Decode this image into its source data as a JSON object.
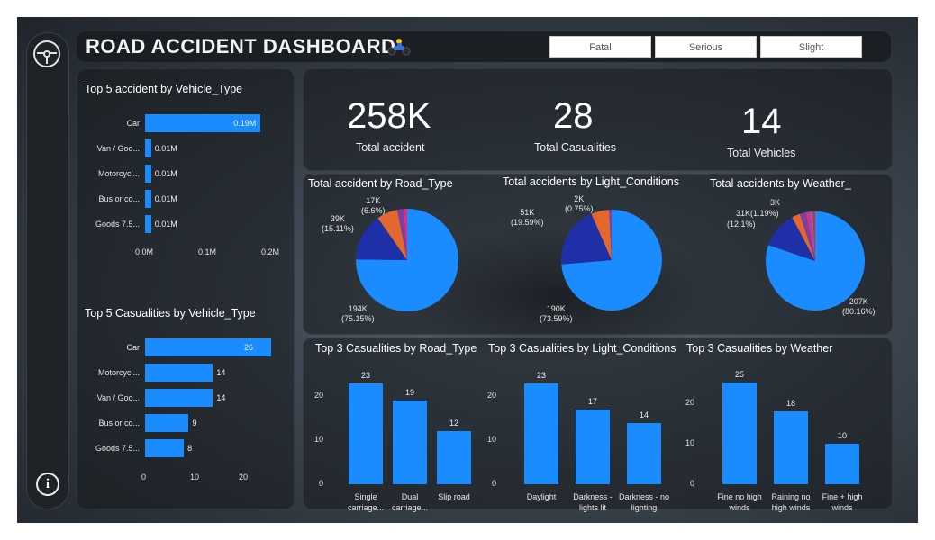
{
  "header": {
    "title": "ROAD ACCIDENT DASHBOARD",
    "slicers": [
      "Fatal",
      "Serious",
      "Slight"
    ]
  },
  "kpis": [
    {
      "value": "258K",
      "label": "Total accident"
    },
    {
      "value": "28",
      "label": "Total Casualities"
    },
    {
      "value": "14",
      "label": "Total Vehicles"
    }
  ],
  "icons": {
    "nav_top": "steering-wheel-icon",
    "nav_bottom": "info-icon",
    "title_icon": "motorbike-rider-icon"
  },
  "colors": {
    "bar": "#1a8cff",
    "pie_main": "#1a8cff",
    "pie_second": "#1f2fa8",
    "pie_third": "#e3682f",
    "pie_fourth": "#7b3fa8",
    "pie_fifth": "#d6337a"
  },
  "chart_data": [
    {
      "type": "bar",
      "orientation": "horizontal",
      "title": "Top 5 accident by Vehicle_Type",
      "categories": [
        "Car",
        "Van / Goo...",
        "Motorcycl...",
        "Bus or co...",
        "Goods 7.5..."
      ],
      "values": [
        0.19,
        0.01,
        0.01,
        0.01,
        0.01
      ],
      "data_labels": [
        "0.19M",
        "0.01M",
        "0.01M",
        "0.01M",
        "0.01M"
      ],
      "xticks": [
        "0.0M",
        "0.1M",
        "0.2M"
      ],
      "xlim": [
        0,
        0.2
      ]
    },
    {
      "type": "bar",
      "orientation": "horizontal",
      "title": "Top 5 Casualities by Vehicle_Type",
      "categories": [
        "Car",
        "Motorcycl...",
        "Van / Goo...",
        "Bus or co...",
        "Goods 7.5..."
      ],
      "values": [
        26,
        14,
        14,
        9,
        8
      ],
      "data_labels": [
        "26",
        "14",
        "14",
        "9",
        "8"
      ],
      "xticks": [
        "0",
        "10",
        "20"
      ],
      "xlim": [
        0,
        26
      ]
    },
    {
      "type": "pie",
      "title": "Total accident by Road_Type",
      "values": [
        194,
        39,
        17,
        5,
        3
      ],
      "labels": [
        {
          "value": "194K",
          "pct": "(75.15%)"
        },
        {
          "value": "39K",
          "pct": "(15.11%)"
        },
        {
          "value": "17K",
          "pct": "(6.6%)"
        }
      ]
    },
    {
      "type": "pie",
      "title": "Total accidents by Light_Conditions",
      "values": [
        190,
        51,
        15,
        2
      ],
      "labels": [
        {
          "value": "190K",
          "pct": "(73.59%)"
        },
        {
          "value": "51K",
          "pct": "(19.59%)"
        },
        {
          "value": "2K",
          "pct": "(0.75%)"
        }
      ]
    },
    {
      "type": "pie",
      "title": "Total accidents by Weather_",
      "values": [
        207,
        31,
        7,
        5,
        3,
        3,
        2
      ],
      "labels": [
        {
          "value": "207K",
          "pct": "(80.16%)"
        },
        {
          "value": "31K",
          "pct": "(12.1%)"
        },
        {
          "value": "3K",
          "pct": "(1.19%)"
        }
      ]
    },
    {
      "type": "bar",
      "title": "Top 3 Casualities by Road_Type",
      "categories": [
        "Single carriage...",
        "Dual carriage...",
        "Slip road"
      ],
      "values": [
        23,
        19,
        12
      ],
      "yticks": [
        "0",
        "10",
        "20"
      ],
      "ylim": [
        0,
        25
      ]
    },
    {
      "type": "bar",
      "title": "Top 3 Casualities by Light_Conditions",
      "categories": [
        "Daylight",
        "Darkness - lights lit",
        "Darkness - no lighting"
      ],
      "values": [
        23,
        17,
        14
      ],
      "yticks": [
        "0",
        "10",
        "20"
      ],
      "ylim": [
        0,
        25
      ]
    },
    {
      "type": "bar",
      "title": "Top 3 Casualities by Weather",
      "categories": [
        "Fine no high winds",
        "Raining no high winds",
        "Fine + high winds"
      ],
      "values": [
        25,
        18,
        10
      ],
      "yticks": [
        "0",
        "10",
        "20"
      ],
      "ylim": [
        0,
        27
      ]
    }
  ]
}
